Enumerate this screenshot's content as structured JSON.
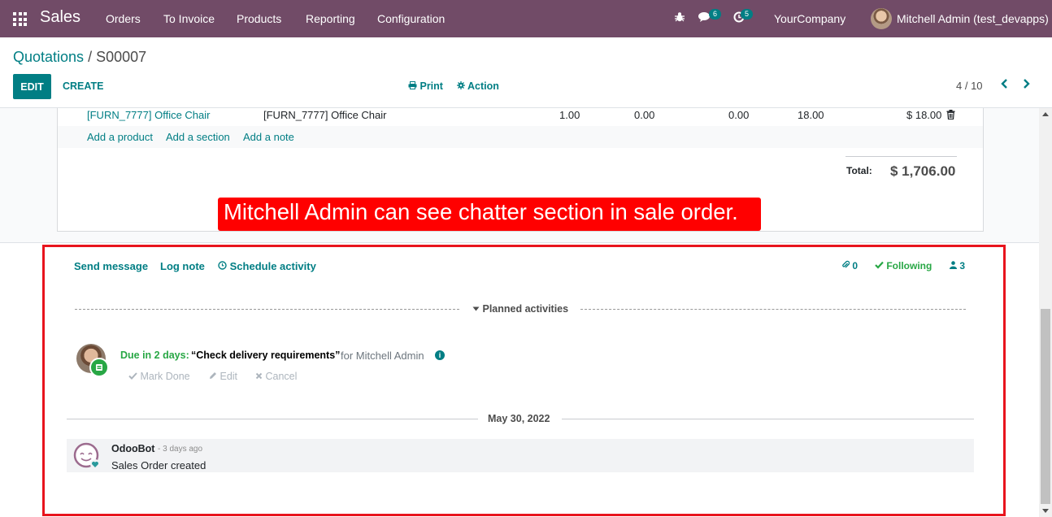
{
  "navbar": {
    "app_name": "Sales",
    "menus": [
      "Orders",
      "To Invoice",
      "Products",
      "Reporting",
      "Configuration"
    ],
    "messages_count": "6",
    "activities_count": "5",
    "company": "YourCompany",
    "user": "Mitchell Admin (test_devapps)"
  },
  "breadcrumb": {
    "parent": "Quotations",
    "separator": " / ",
    "current": "S00007"
  },
  "toolbar": {
    "edit_label": "EDIT",
    "create_label": "CREATE",
    "print_label": "Print",
    "action_label": "Action",
    "pager_value": "4 / 10"
  },
  "order_line": {
    "product": "[FURN_7777] Office Chair",
    "description": "[FURN_7777] Office Chair",
    "quantity": "1.00",
    "col_a": "0.00",
    "col_b": "0.00",
    "col_c": "18.00",
    "subtotal": "$ 18.00"
  },
  "order_actions": {
    "add_product": "Add a product",
    "add_section": "Add a section",
    "add_note": "Add a note"
  },
  "totals": {
    "label": "Total:",
    "value": "$ 1,706.00"
  },
  "callout": "Mitchell Admin can see chatter section in sale order.",
  "chatter": {
    "send_message": "Send message",
    "log_note": "Log note",
    "schedule_activity": "Schedule activity",
    "attachments": "0",
    "following": "Following",
    "followers": "3",
    "planned_title": "Planned activities",
    "activity": {
      "due": "Due in 2 days:",
      "summary": "“Check delivery requirements”",
      "for_user": "for Mitchell Admin",
      "mark_done": "Mark Done",
      "edit": "Edit",
      "cancel": "Cancel"
    },
    "date_separator": "May 30, 2022",
    "message": {
      "author": "OdooBot",
      "time": "- 3 days ago",
      "body": "Sales Order created"
    }
  },
  "colors": {
    "navbar": "#714b67",
    "primary": "#017e84",
    "success": "#28a745",
    "highlight": "#e8141d"
  }
}
